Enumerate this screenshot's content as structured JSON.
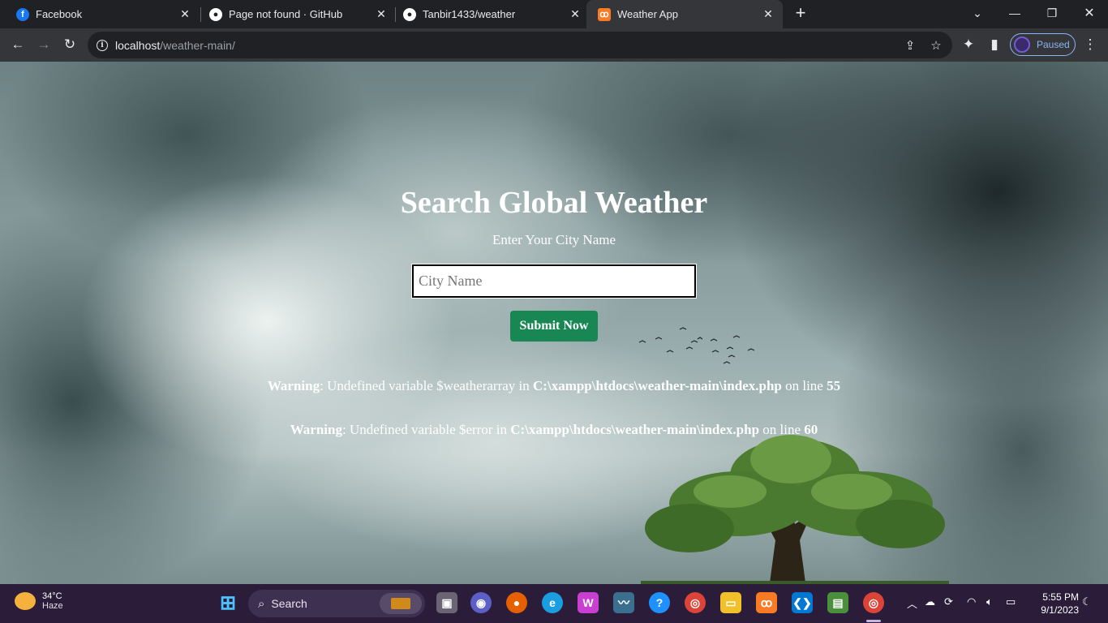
{
  "browser": {
    "tabs": [
      {
        "title": "Facebook",
        "icon": "facebook-icon",
        "color": "#1877f2"
      },
      {
        "title": "Page not found · GitHub",
        "icon": "github-icon",
        "color": "#ffffff"
      },
      {
        "title": "Tanbir1433/weather",
        "icon": "github-icon",
        "color": "#ffffff"
      },
      {
        "title": "Weather App",
        "icon": "xampp-icon",
        "color": "#fb7a24",
        "active": true
      }
    ],
    "new_tab": "+",
    "url_host": "localhost",
    "url_path": "/weather-main/",
    "profile_status": "Paused"
  },
  "page": {
    "heading": "Search Global Weather",
    "subheading": "Enter Your City Name",
    "input_placeholder": "City Name",
    "input_value": "",
    "submit_label": "Submit Now",
    "submit_color": "#198754",
    "warnings": [
      {
        "label": "Warning",
        "message": ": Undefined variable $weatherarray in ",
        "file": "C:\\xampp\\htdocs\\weather-main\\index.php",
        "on_line": " on line ",
        "line": "55"
      },
      {
        "label": "Warning",
        "message": ": Undefined variable $error in ",
        "file": "C:\\xampp\\htdocs\\weather-main\\index.php",
        "on_line": " on line ",
        "line": "60"
      }
    ]
  },
  "taskbar": {
    "weather_temp": "34°C",
    "weather_condition": "Haze",
    "search_label": "Search",
    "time": "5:55 PM",
    "date": "9/1/2023",
    "accent": "#2b1d3a"
  }
}
